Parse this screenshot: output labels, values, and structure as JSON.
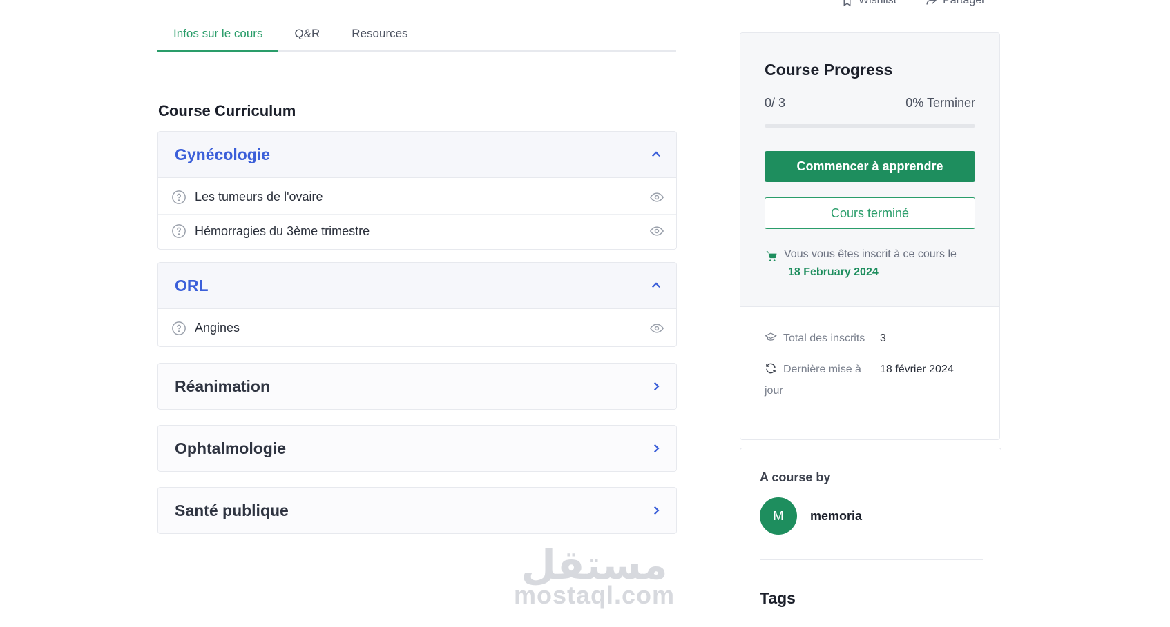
{
  "top_actions": {
    "wishlist": "Wishlist",
    "share": "Partager"
  },
  "tabs": [
    {
      "label": "Infos sur le cours"
    },
    {
      "label": "Q&R"
    },
    {
      "label": "Resources"
    }
  ],
  "curriculum": {
    "title": "Course Curriculum",
    "sections": [
      {
        "title": "Gynécologie",
        "lessons": [
          "Les tumeurs de l'ovaire",
          "Hémorragies du 3ème trimestre"
        ]
      },
      {
        "title": "ORL",
        "lessons": [
          "Angines"
        ]
      },
      {
        "title": "Réanimation"
      },
      {
        "title": "Ophtalmologie"
      },
      {
        "title": "Santé publique"
      }
    ]
  },
  "progress": {
    "title": "Course Progress",
    "count": "0/ 3",
    "percent_label": "0% Terminer",
    "percent": 0,
    "start_button": "Commencer à apprendre",
    "done_button": "Cours terminé",
    "enrolled_text": "Vous vous êtes inscrit à ce cours le",
    "enrolled_date": "18 February 2024"
  },
  "meta": {
    "total_label": "Total des inscrits",
    "total_value": "3",
    "updated_label": "Dernière mise à jour",
    "updated_value": "18 février 2024"
  },
  "author": {
    "title": "A course by",
    "initial": "M",
    "name": "memoria"
  },
  "tags_title": "Tags",
  "watermark": {
    "arabic": "مستقل",
    "latin": "mostaql.com"
  },
  "colors": {
    "accent": "#2a9d6a",
    "button": "#1e8e5e",
    "link_blue": "#3b5fd9"
  }
}
